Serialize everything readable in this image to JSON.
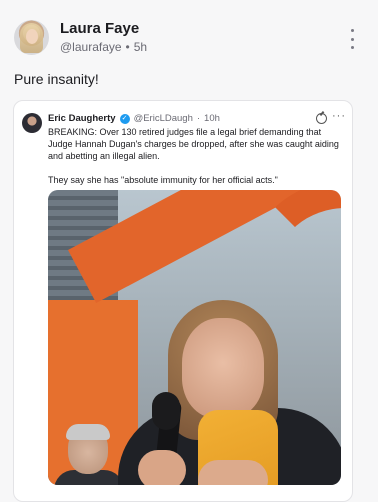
{
  "post": {
    "author_name": "Laura Faye",
    "handle": "@laurafaye",
    "separator": "•",
    "time": "5h",
    "text": "Pure insanity!",
    "menu_icon": "more-vertical-icon"
  },
  "embedded_post": {
    "author_name": "Eric Daugherty",
    "verified_icon": "verified-badge-icon",
    "handle": "@EricLDaugh",
    "separator": "·",
    "time": "10h",
    "more_label": "···",
    "paragraph_1": "BREAKING: Over 130 retired judges file a legal brief demanding that Judge Hannah Dugan's charges be dropped, after she was caught aiding and abetting an illegal alien.",
    "paragraph_2": "They say she has \"absolute immunity for her official acts.\""
  },
  "colors": {
    "background": "#f7f7f8",
    "verified": "#1d9bf0",
    "scarf": "#f2b035",
    "sculpture": "#e2652b"
  }
}
